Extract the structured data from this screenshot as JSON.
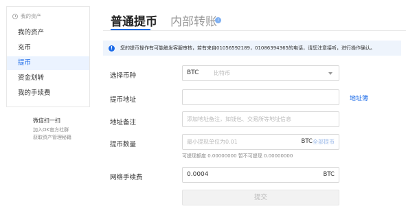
{
  "sidebar": {
    "header": "我的资产",
    "items": [
      {
        "label": "我的资产",
        "active": false
      },
      {
        "label": "充币",
        "active": false
      },
      {
        "label": "提币",
        "active": true
      },
      {
        "label": "资金划转",
        "active": false
      },
      {
        "label": "我的手续费",
        "active": false
      }
    ],
    "qr": {
      "title": "微信扫一扫",
      "line1": "加入OK官方社群",
      "line2": "获取资产管理秘籍"
    }
  },
  "tabs": [
    {
      "label": "普通提币",
      "active": true
    },
    {
      "label": "内部转账",
      "active": false
    }
  ],
  "notice": {
    "text": "您的提币操作有可能触发客服审核，若有来自01056592189，01086394365的电话，请您注意接听，进行操作确认。"
  },
  "form": {
    "coin": {
      "label": "选择币种",
      "value": "BTC",
      "sub": "比特币"
    },
    "address": {
      "label": "提币地址",
      "value": "",
      "link": "地址簿"
    },
    "remark": {
      "label": "地址备注",
      "placeholder": "添加地址备注，如钱包、交易所等地址信息"
    },
    "amount": {
      "label": "提币数量",
      "placeholder": "最小提现单位为0.01",
      "unit": "BTC",
      "all_label": "全部提币",
      "hint": "可提现额度 0.00000000   暂不可提现 0.00000000"
    },
    "fee": {
      "label": "网络手续费",
      "value": "0.0004",
      "unit": "BTC"
    },
    "submit_label": "提交"
  },
  "colors": {
    "accent": "#1a6ae8",
    "active_bg": "#ebf3ff",
    "notice_bg": "#eef4fc"
  }
}
